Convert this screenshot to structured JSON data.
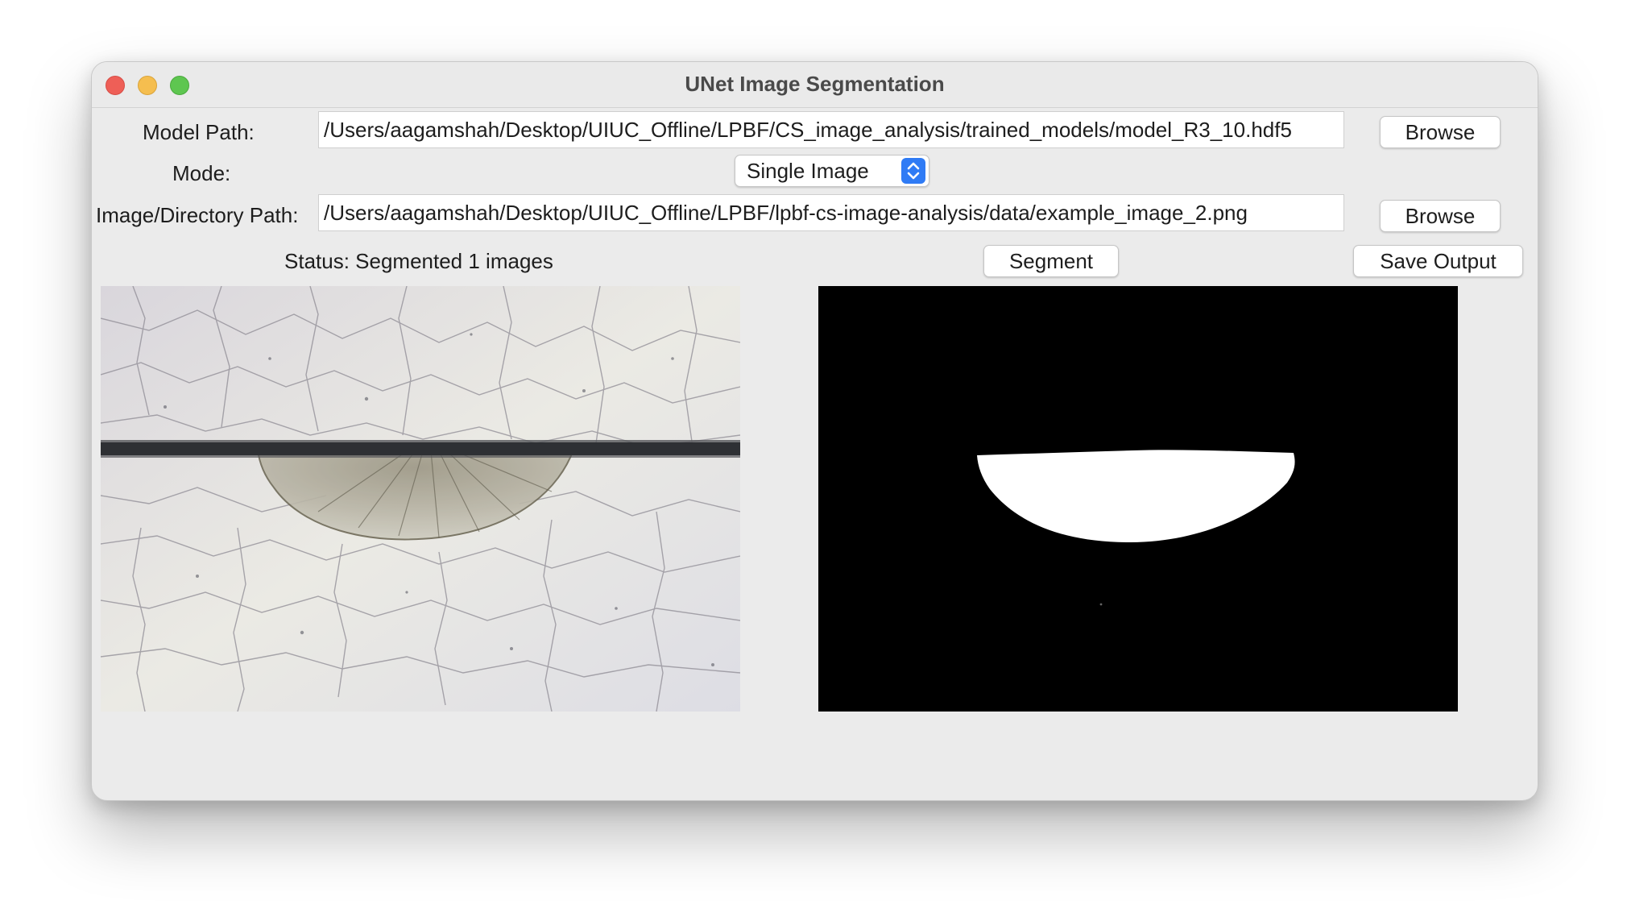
{
  "window": {
    "title": "UNet Image Segmentation"
  },
  "model_path": {
    "label": "Model Path:",
    "value": "/Users/aagamshah/Desktop/UIUC_Offline/LPBF/CS_image_analysis/trained_models/model_R3_10.hdf5",
    "browse_label": "Browse"
  },
  "mode": {
    "label": "Mode:",
    "selected": "Single Image"
  },
  "image_path": {
    "label": "Image/Directory Path:",
    "value": "/Users/aagamshah/Desktop/UIUC_Offline/LPBF/lpbf-cs-image-analysis/data/example_image_2.png",
    "browse_label": "Browse"
  },
  "status": {
    "text": "Status: Segmented 1 images"
  },
  "actions": {
    "segment_label": "Segment",
    "save_label": "Save Output"
  },
  "images": {
    "input_icon": "micrograph-image",
    "output_icon": "segmentation-mask-image"
  }
}
